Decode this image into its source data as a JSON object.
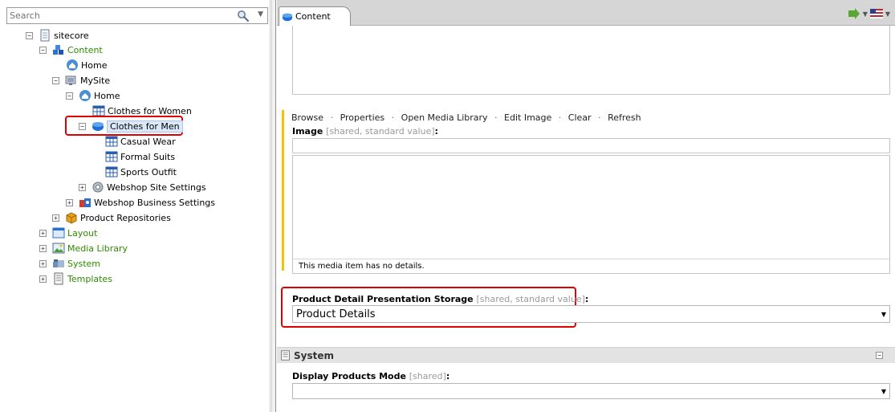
{
  "search": {
    "placeholder": "Search"
  },
  "tree": {
    "sitecore": "sitecore",
    "content": "Content",
    "home_root": "Home",
    "mysite": "MySite",
    "home": "Home",
    "clothes_women": "Clothes for Women",
    "clothes_men": "Clothes for Men",
    "casual_wear": "Casual Wear",
    "formal_suits": "Formal Suits",
    "sports_outfit": "Sports Outfit",
    "webshop_site_settings": "Webshop Site Settings",
    "webshop_business_settings": "Webshop Business Settings",
    "product_repositories": "Product Repositories",
    "layout": "Layout",
    "media_library": "Media Library",
    "system": "System",
    "templates": "Templates"
  },
  "tabs": {
    "content": "Content"
  },
  "media_toolbar": {
    "browse": "Browse",
    "properties": "Properties",
    "open_media_library": "Open Media Library",
    "edit_image": "Edit Image",
    "clear": "Clear",
    "refresh": "Refresh",
    "separator": "·"
  },
  "image_field": {
    "title": "Image",
    "meta": "[shared, standard value]",
    "colon": ":",
    "details": "This media item has no details."
  },
  "product_detail_field": {
    "title": "Product Detail Presentation Storage",
    "meta": "[shared, standard value]",
    "colon": ":",
    "value": "Product Details"
  },
  "system_section": {
    "title": "System"
  },
  "display_products_field": {
    "title": "Display Products Mode",
    "meta": "[shared]",
    "colon": ":",
    "value": ""
  },
  "colors": {
    "highlight": "#e00000",
    "tree_green": "#2e8b00",
    "yellow_bar": "#f5c200"
  }
}
